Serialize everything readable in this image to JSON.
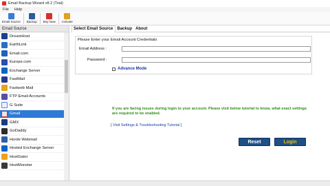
{
  "window": {
    "title": "Email Backup Wizard v8.2 (Trial)"
  },
  "menu": {
    "items": [
      "File",
      "Help"
    ]
  },
  "toolbar": {
    "email_source": "Email Source",
    "backup": "Backup",
    "buy_now": "Buy Now",
    "activate": "Activate"
  },
  "sidebar": {
    "header": "Email Source",
    "items": [
      {
        "label": "DreamHost",
        "icon": "dreamhost-icon",
        "color": "#1b3f8a"
      },
      {
        "label": "EarthLink",
        "icon": "earthlink-icon",
        "color": "#2a6fbf"
      },
      {
        "label": "Email.com",
        "icon": "email-com-icon",
        "color": "#1e63b8"
      },
      {
        "label": "Europe.com",
        "icon": "europe-com-icon",
        "color": "#2a4fb0"
      },
      {
        "label": "Exchange Server",
        "icon": "exchange-icon",
        "color": "#0b63c7"
      },
      {
        "label": "FastMail",
        "icon": "fastmail-icon",
        "color": "#233a8c"
      },
      {
        "label": "Fastweb Mail",
        "icon": "fastweb-icon",
        "color": "#e8a317"
      },
      {
        "label": "FTP Email Accounts",
        "icon": "ftp-icon",
        "color": "#5a4ca8"
      },
      {
        "label": "G Suite",
        "icon": "gsuite-icon",
        "color": "#f0f0f0"
      },
      {
        "label": "Gmail",
        "icon": "gmail-icon",
        "color": "#e6e6e6"
      },
      {
        "label": "GMX",
        "icon": "gmx-icon",
        "color": "#1c3d7a"
      },
      {
        "label": "GoDaddy",
        "icon": "godaddy-icon",
        "color": "#2c2c2c"
      },
      {
        "label": "Horde Webmail",
        "icon": "horde-icon",
        "color": "#2b5ea8"
      },
      {
        "label": "Hosted Exchange Server",
        "icon": "hosted-exchange-icon",
        "color": "#0b63c7"
      },
      {
        "label": "HostGator",
        "icon": "hostgator-icon",
        "color": "#f2a01c"
      },
      {
        "label": "HostMonster",
        "icon": "hostmonster-icon",
        "color": "#3a3a3a"
      }
    ],
    "selected_index": 9
  },
  "tabs": [
    "Select Email Source",
    "Backup",
    "About"
  ],
  "credentials": {
    "legend": "Please Enter your Email Account Credentials",
    "email_label": "Email Address :",
    "email_value": "",
    "password_label": "Password :",
    "password_value": "",
    "advance_mode": "Advance Mode"
  },
  "help": {
    "message": "If you are facing issues during login to your account. Please visit below tutorial to know, what exact settings are required to be enabled.",
    "link": "[ Visit Settings & Troubleshooting Tutorial ]"
  },
  "buttons": {
    "reset": "Reset",
    "login": "Login"
  }
}
